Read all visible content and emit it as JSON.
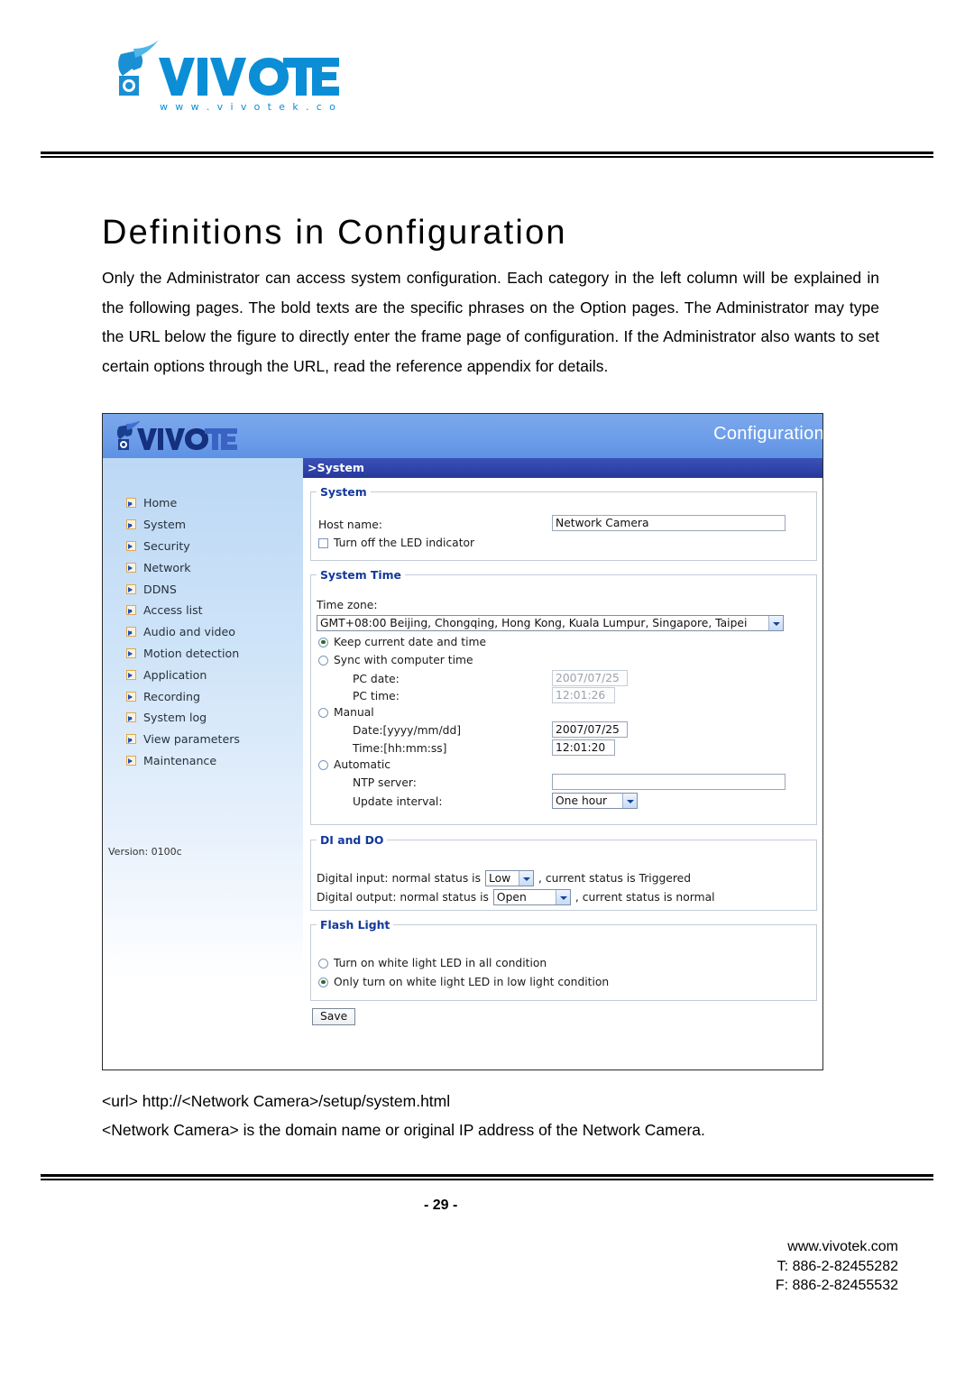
{
  "brand": {
    "name": "VIVOTEK",
    "tagline": "w w w . v i v o t e k . c o m",
    "accent_color": "#0a8fd8"
  },
  "page_title": "Definitions in Configuration",
  "intro_paragraph": "Only the Administrator can access system configuration. Each category in the left column will be explained in the following pages. The bold texts are the specific phrases on the Option pages. The Administrator may type the URL below the figure to directly enter the frame page of configuration. If the Administrator also wants to set certain options through the URL, read the reference appendix for details.",
  "screenshot": {
    "topbar": {
      "brand": "VIVOTEK",
      "right_label": "Configuration"
    },
    "tabbar": {
      "label": ">System"
    },
    "sidebar": {
      "items": [
        {
          "label": "Home"
        },
        {
          "label": "System"
        },
        {
          "label": "Security"
        },
        {
          "label": "Network"
        },
        {
          "label": "DDNS"
        },
        {
          "label": "Access list"
        },
        {
          "label": "Audio and video"
        },
        {
          "label": "Motion detection"
        },
        {
          "label": "Application"
        },
        {
          "label": "Recording"
        },
        {
          "label": "System log"
        },
        {
          "label": "View parameters"
        },
        {
          "label": "Maintenance"
        }
      ],
      "version": "Version: 0100c"
    },
    "system_group": {
      "legend": "System",
      "host_name_label": "Host name:",
      "host_name_value": "Network Camera",
      "led_checkbox_label": "Turn off the LED indicator",
      "led_checkbox_checked": false
    },
    "system_time_group": {
      "legend": "System Time",
      "time_zone_label": "Time zone:",
      "time_zone_value": "GMT+08:00 Beijing, Chongqing, Hong Kong, Kuala Lumpur, Singapore, Taipei",
      "option_keep": "Keep current date and time",
      "option_sync": "Sync with computer time",
      "pc_date_label": "PC date:",
      "pc_date_value": "2007/07/25",
      "pc_time_label": "PC time:",
      "pc_time_value": "12:01:26",
      "option_manual": "Manual",
      "manual_date_label": "Date:[yyyy/mm/dd]",
      "manual_date_value": "2007/07/25",
      "manual_time_label": "Time:[hh:mm:ss]",
      "manual_time_value": "12:01:20",
      "option_automatic": "Automatic",
      "ntp_server_label": "NTP server:",
      "ntp_server_value": "",
      "update_interval_label": "Update interval:",
      "update_interval_value": "One hour",
      "selected_option": "keep"
    },
    "di_do_group": {
      "legend": "DI and DO",
      "di_prefix": "Digital input: normal status is",
      "di_value": "Low",
      "di_suffix": ", current status is Triggered",
      "do_prefix": "Digital output: normal status is",
      "do_value": "Open",
      "do_suffix": ", current status is normal"
    },
    "flash_light_group": {
      "legend": "Flash Light",
      "option_all": "Turn on white light LED in all condition",
      "option_low": "Only turn on white light LED in low light condition",
      "selected_option": "low"
    },
    "save_button": "Save"
  },
  "url_lines": {
    "line1": "<url> http://<Network Camera>/setup/system.html",
    "line2": "<Network Camera> is the domain name or original IP address of the Network Camera."
  },
  "footer": {
    "page_number": "- 29 -",
    "website": "www.vivotek.com",
    "tel": "T: 886-2-82455282",
    "fax": "F: 886-2-82455532"
  }
}
